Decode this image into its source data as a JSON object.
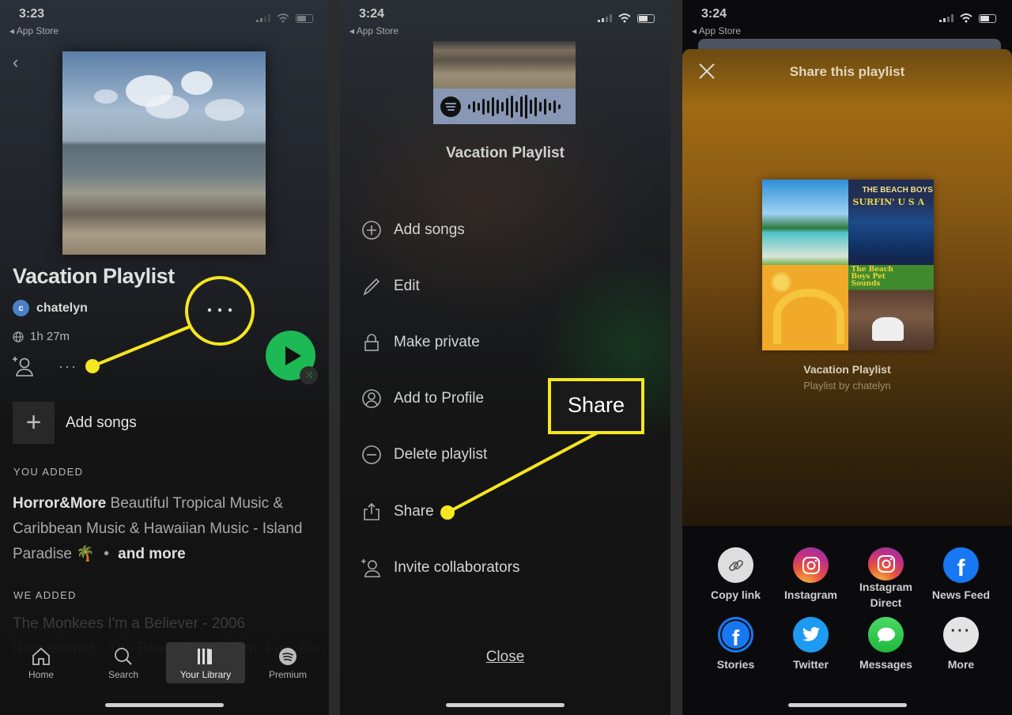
{
  "colors": {
    "spotify_green": "#1db954",
    "annotation_yellow": "#f5e620",
    "share_sheet_accent": "#a06a14"
  },
  "panel1": {
    "status": {
      "time": "3:23",
      "back_app": "App Store"
    },
    "playlist_title": "Vacation Playlist",
    "owner": {
      "initial": "c",
      "name": "chatelyn"
    },
    "duration": "1h 27m",
    "more_dots": "···",
    "add_songs_label": "Add songs",
    "you_added_label": "YOU ADDED",
    "you_added": {
      "artist": "Horror&More",
      "text": "Beautiful Tropical Music & Caribbean Music & Hawaiian Music - Island Paradise 🌴",
      "separator": "•",
      "more": "and more"
    },
    "we_added_label": "WE ADDED",
    "we_added_line1": "The Monkees I'm a Believer - 2006",
    "we_added_line2": "Remastered · The Beach Boys · Fun, Fun, Fun",
    "tabs": [
      {
        "label": "Home",
        "icon": "home-icon"
      },
      {
        "label": "Search",
        "icon": "search-icon"
      },
      {
        "label": "Your Library",
        "icon": "library-icon",
        "active": true
      },
      {
        "label": "Premium",
        "icon": "spotify-icon"
      }
    ]
  },
  "panel2": {
    "status": {
      "time": "3:24",
      "back_app": "App Store"
    },
    "playlist_title": "Vacation Playlist",
    "menu": [
      {
        "label": "Add songs",
        "icon": "plus-circle-icon"
      },
      {
        "label": "Edit",
        "icon": "pencil-icon"
      },
      {
        "label": "Make private",
        "icon": "lock-icon"
      },
      {
        "label": "Add to Profile",
        "icon": "profile-icon"
      },
      {
        "label": "Delete playlist",
        "icon": "minus-circle-icon"
      },
      {
        "label": "Share",
        "icon": "share-icon"
      },
      {
        "label": "Invite collaborators",
        "icon": "add-user-icon"
      }
    ],
    "callout_label": "Share",
    "close_label": "Close"
  },
  "panel3": {
    "status": {
      "time": "3:24",
      "back_app": "App Store"
    },
    "header": "Share this playlist",
    "collage_text": {
      "beach_boys": "THE BEACH BOYS",
      "surfin": "SURFIN' U S A",
      "pet_sounds": "The Beach Boys Pet Sounds"
    },
    "playlist_title": "Vacation Playlist",
    "playlist_sub": "Playlist by chatelyn",
    "share_options": [
      {
        "label": "Copy link",
        "icon": "link-icon"
      },
      {
        "label": "Instagram",
        "icon": "instagram-icon"
      },
      {
        "label": "Instagram Direct",
        "icon": "instagram-icon"
      },
      {
        "label": "News Feed",
        "icon": "facebook-icon"
      },
      {
        "label": "Stories",
        "icon": "facebook-stories-icon"
      },
      {
        "label": "Twitter",
        "icon": "twitter-icon"
      },
      {
        "label": "Messages",
        "icon": "messages-icon"
      },
      {
        "label": "More",
        "icon": "more-icon"
      }
    ]
  }
}
